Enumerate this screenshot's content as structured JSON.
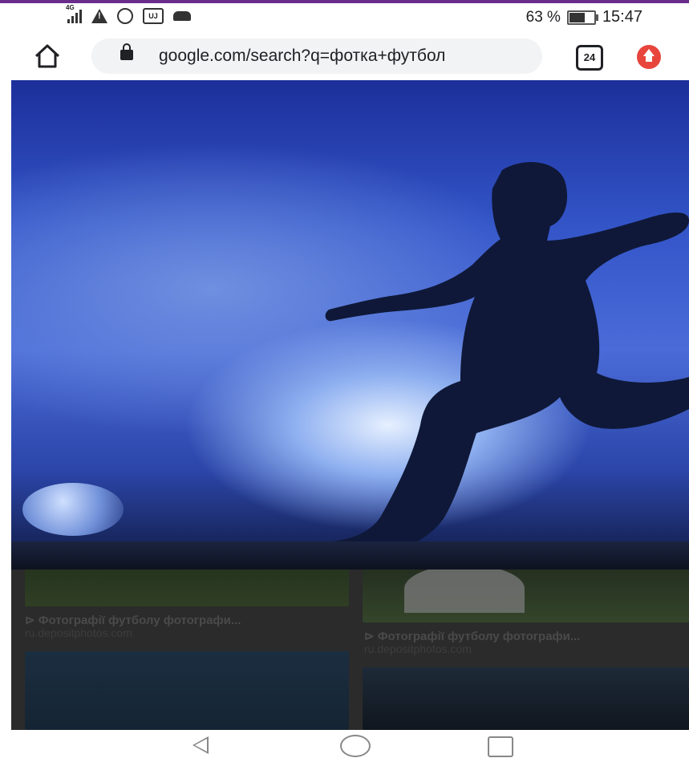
{
  "status_bar": {
    "network_label": "4G",
    "battery_percent": "63 %",
    "battery_level": 63,
    "time": "15:47",
    "icons": [
      "signal-icon",
      "warning-icon",
      "whatsapp-icon",
      "app-notification-icon",
      "cast-icon",
      "battery-icon"
    ]
  },
  "browser": {
    "url": "google.com/search?q=фотка+футбол",
    "tab_count": "24",
    "accent_color": "#e8453c"
  },
  "results": [
    {
      "title": "⊳ Фотографії футболу фотографи...",
      "source": "ru.depositphotos.com"
    },
    {
      "title": "⊳ Фотографії футболу фотографи...",
      "source": "ru.depositphotos.com"
    }
  ],
  "navigation": {
    "icons": [
      "back-icon",
      "home-circle-icon",
      "recent-apps-icon"
    ]
  }
}
